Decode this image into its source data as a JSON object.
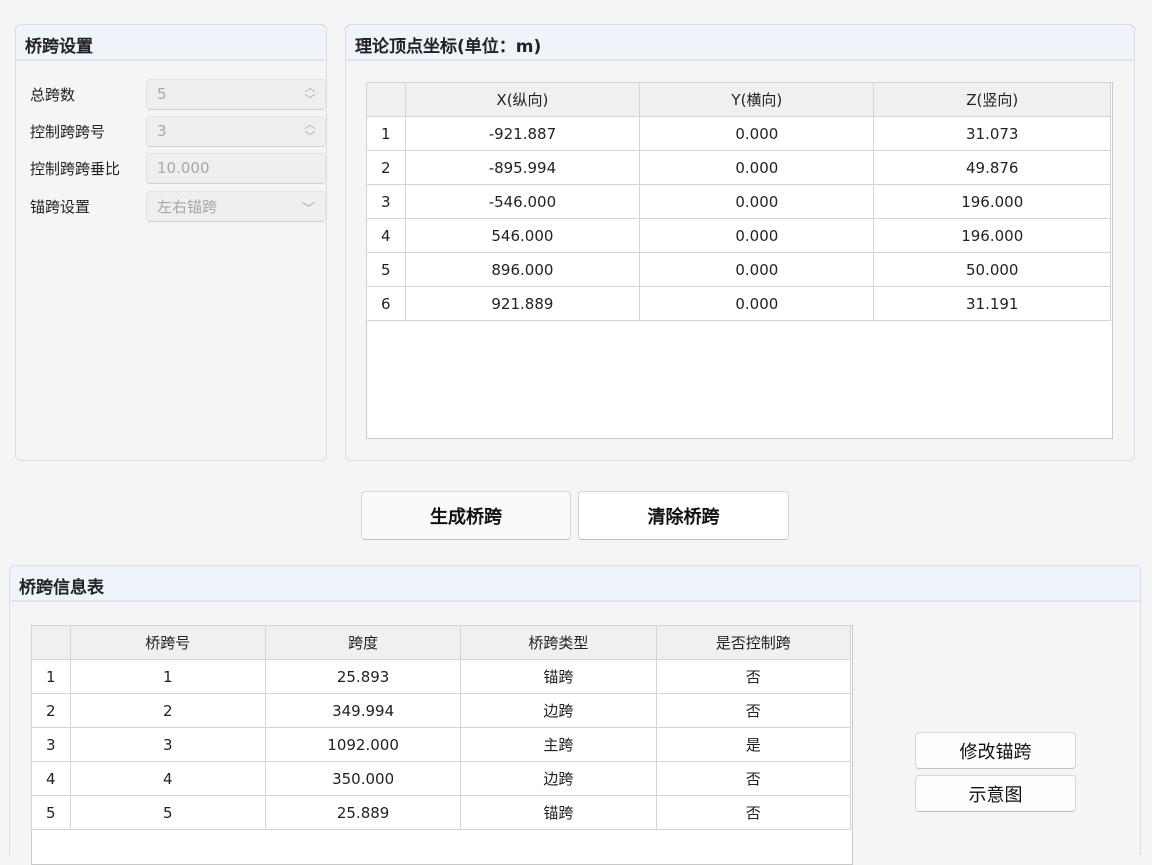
{
  "span_settings": {
    "title": "桥跨设置",
    "fields": [
      {
        "label": "总跨数",
        "value": "5",
        "control": "spinbox"
      },
      {
        "label": "控制跨跨号",
        "value": "3",
        "control": "spinbox"
      },
      {
        "label": "控制跨跨垂比",
        "value": "10.000",
        "control": "text"
      },
      {
        "label": "锚跨设置",
        "value": "左右锚跨",
        "control": "combobox"
      }
    ]
  },
  "coords": {
    "title": "理论顶点坐标(单位：m)",
    "columns": [
      "",
      "X(纵向)",
      "Y(横向)",
      "Z(竖向)"
    ],
    "rows": [
      [
        "1",
        "-921.887",
        "0.000",
        "31.073"
      ],
      [
        "2",
        "-895.994",
        "0.000",
        "49.876"
      ],
      [
        "3",
        "-546.000",
        "0.000",
        "196.000"
      ],
      [
        "4",
        "546.000",
        "0.000",
        "196.000"
      ],
      [
        "5",
        "896.000",
        "0.000",
        "50.000"
      ],
      [
        "6",
        "921.889",
        "0.000",
        "31.191"
      ]
    ]
  },
  "actions": {
    "generate_label": "生成桥跨",
    "clear_label": "清除桥跨"
  },
  "span_info": {
    "title": "桥跨信息表",
    "columns": [
      "",
      "桥跨号",
      "跨度",
      "桥跨类型",
      "是否控制跨"
    ],
    "rows": [
      [
        "1",
        "1",
        "25.893",
        "锚跨",
        "否"
      ],
      [
        "2",
        "2",
        "349.994",
        "边跨",
        "否"
      ],
      [
        "3",
        "3",
        "1092.000",
        "主跨",
        "是"
      ],
      [
        "4",
        "4",
        "350.000",
        "边跨",
        "否"
      ],
      [
        "5",
        "5",
        "25.889",
        "锚跨",
        "否"
      ]
    ],
    "modify_anchor_label": "修改锚跨",
    "diagram_label": "示意图"
  }
}
